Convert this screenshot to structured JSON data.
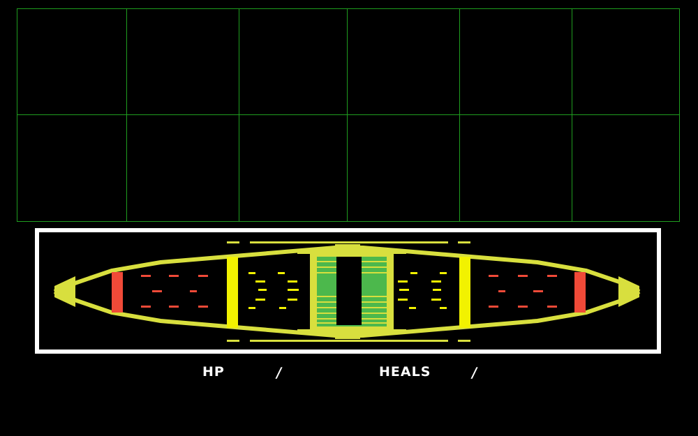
{
  "hud": {
    "hp_label": "HP",
    "hp_separator": "/",
    "heals_label": "HEALS",
    "heals_separator": "/"
  },
  "colors": {
    "grid": "#1f9e1f",
    "frame": "#ffffff",
    "lime": "#d8df3e",
    "yellow": "#f2f200",
    "green": "#4cb84c",
    "red": "#f04a38"
  }
}
